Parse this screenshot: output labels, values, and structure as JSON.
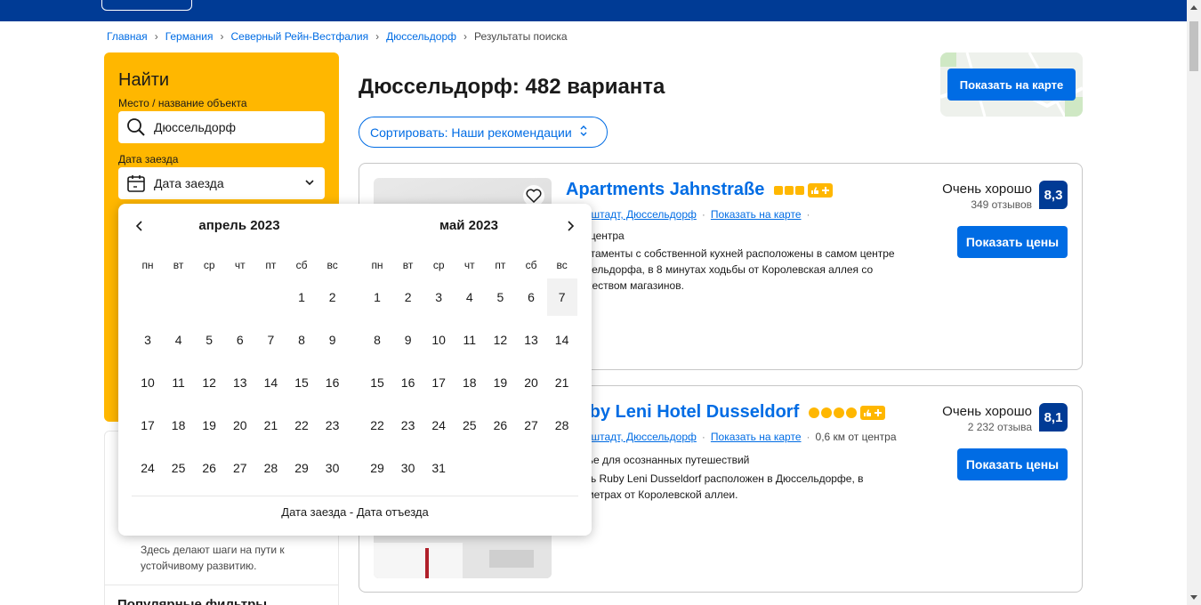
{
  "breadcrumb": [
    {
      "label": "Главная"
    },
    {
      "label": "Германия"
    },
    {
      "label": "Северный Рейн-Вестфалия"
    },
    {
      "label": "Дюссельдорф"
    },
    {
      "label": "Результаты поиска"
    }
  ],
  "search": {
    "title": "Найти",
    "destination_label": "Место / название объекта",
    "destination_value": "Дюссельдорф",
    "checkin_label": "Дата заезда",
    "checkin_value": "Дата заезда"
  },
  "sidebar": {
    "text": "Здесь делают шаги на пути к устойчивому развитию.",
    "heading": "Популярные фильтры"
  },
  "results": {
    "title": "Дюссельдорф: 482 варианта",
    "sort_label": "Сортировать: Наши рекомендации",
    "map_button": "Показать на карте"
  },
  "hotels": [
    {
      "name": "Apartments Jahnstraße",
      "star_type": "square",
      "stars": 3,
      "district": "Фрихштадт, Дюссельдорф",
      "map_link": "Показать на карте",
      "distance": "м от центра",
      "desc": "Апартаменты с собственной кухней расположены в самом центре Дюссельдорфа, в 8 минутах ходьбы от Королевская аллея со множеством магазинов.",
      "desc2": "",
      "rating_word": "Очень хорошо",
      "reviews": "349 отзывов",
      "score": "8,3",
      "price_button": "Показать цены"
    },
    {
      "name": "Ruby Leni Hotel Dusseldorf",
      "star_type": "round",
      "stars": 4,
      "district": "Фрихштадт, Дюссельдорф",
      "map_link": "Показать на карте",
      "distance": "0,6 км от центра",
      "desc": "Жилье для осознанных путешествий",
      "desc2": "Отель Ruby Leni Dusseldorf расположен в Дюссельдорфе, в 700 метрах от Королевской аллеи.",
      "rating_word": "Очень хорошо",
      "reviews": "2 232 отзыва",
      "score": "8,1",
      "price_button": "Показать цены"
    }
  ],
  "calendar": {
    "weekdays": [
      "пн",
      "вт",
      "ср",
      "чт",
      "пт",
      "сб",
      "вс"
    ],
    "months": [
      {
        "title": "апрель 2023",
        "first_weekday": 5,
        "days": 30
      },
      {
        "title": "май 2023",
        "first_weekday": 0,
        "days": 31,
        "highlighted": 7
      }
    ],
    "footer": "Дата заезда - Дата отъезда"
  },
  "colors": {
    "brand": "#003b95",
    "accent": "#006ce4",
    "search_bg": "#ffb700"
  }
}
